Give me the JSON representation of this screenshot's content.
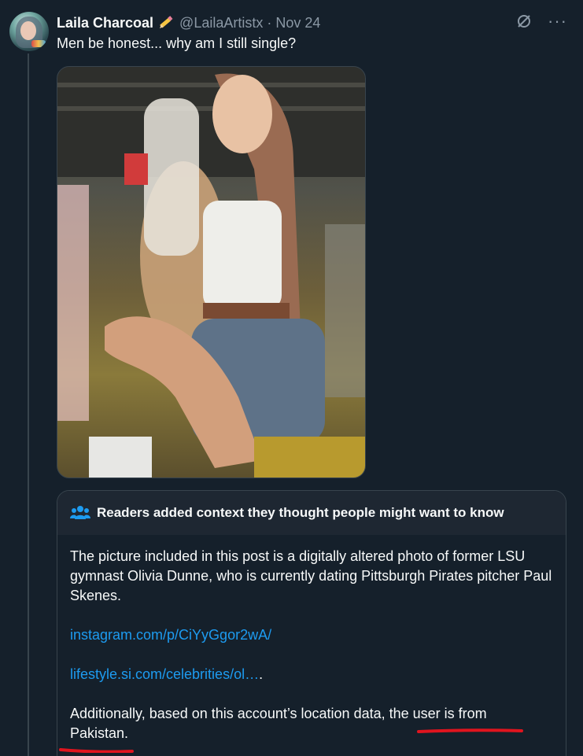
{
  "tweet": {
    "author_name": "Laila Charcoal",
    "author_emoji": "✏️",
    "handle": "@LailaArtistx",
    "separator": "·",
    "date": "Nov 24",
    "text": "Men be honest... why am I still single?",
    "icons": {
      "avatar": "profile-photo",
      "pencil": "pencil-icon",
      "grok": "grok-icon",
      "more": "more-icon"
    },
    "more_label": "···"
  },
  "community_note": {
    "header": "Readers added context they thought people might want to know",
    "paragraph_1": "The picture included in this post is a digitally altered photo of former LSU gymnast Olivia Dunne, who is currently dating Pittsburgh Pirates pitcher Paul Skenes.",
    "link_1": "instagram.com/p/CiYyGgor2wA/",
    "link_2": "lifestyle.si.com/celebrities/ol…",
    "link_2_suffix": ".",
    "paragraph_last_part_1": "Additionally, based on this account’s location data, ",
    "paragraph_last_part_2": "the user is from",
    "paragraph_last_part_3": "Pakistan",
    "paragraph_last_part_4": ".",
    "colors": {
      "link": "#1d9bf0",
      "annotation": "#e0141e"
    }
  }
}
